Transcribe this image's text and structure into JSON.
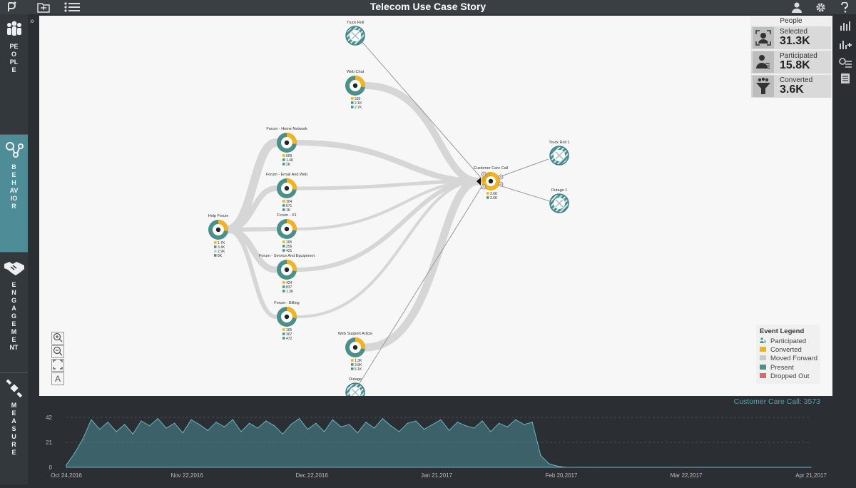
{
  "app": {
    "title": "Telecom Use Case Story",
    "toolbar": {
      "logo_icon": "p-logo-icon",
      "open_icon": "folder-open-icon",
      "list_icon": "list-icon",
      "user_icon": "user-icon",
      "settings_icon": "gear-icon",
      "help_icon": "help-icon"
    }
  },
  "leftnav": {
    "collapse_label": "»",
    "sections": [
      {
        "label": "PEOPLE",
        "icon": "people-icon",
        "active": false
      },
      {
        "label": "BEHAVIOR",
        "icon": "behavior-icon",
        "active": true
      },
      {
        "label": "ENGAGEMENT",
        "icon": "handshake-icon",
        "active": false
      },
      {
        "label": "MEASURE",
        "icon": "satellite-icon",
        "active": false
      }
    ]
  },
  "rightnav": {
    "icons": [
      "bar-chart-icon",
      "add-chart-icon",
      "filter-list-icon",
      "document-icon"
    ]
  },
  "people": {
    "header": "People",
    "cards": [
      {
        "label": "Selected",
        "value": "31.3K",
        "icon": "selected-person-icon"
      },
      {
        "label": "Participated",
        "value": "15.8K",
        "icon": "participated-icon"
      },
      {
        "label": "Converted",
        "value": "3.6K",
        "icon": "funnel-icon"
      }
    ]
  },
  "legend": {
    "title": "Event Legend",
    "items": [
      {
        "label": "Participated",
        "color": "#4a8f8a"
      },
      {
        "label": "Converted",
        "color": "#f0b323"
      },
      {
        "label": "Moved Forward",
        "color": "#c9c9c9"
      },
      {
        "label": "Present",
        "color": "#4a8f8a"
      },
      {
        "label": "Dropped Out",
        "color": "#e06666"
      }
    ]
  },
  "graph": {
    "nodes": [
      {
        "id": "truckroll",
        "label": "Truck Roll",
        "type": "hatched",
        "stats": []
      },
      {
        "id": "webchat",
        "label": "Web Chat",
        "type": "donut",
        "stats": [
          "530",
          "2.1K",
          "2.7K"
        ]
      },
      {
        "id": "home",
        "label": "Forum - Home Network",
        "type": "donut",
        "stats": [
          "669",
          "1.4K",
          "2K"
        ]
      },
      {
        "id": "email",
        "label": "Forum - Email And Web",
        "type": "donut",
        "stats": [
          "304",
          "671",
          "1K"
        ]
      },
      {
        "id": "x1",
        "label": "Forum - X1",
        "type": "donut",
        "stats": [
          "165",
          "256",
          "421"
        ]
      },
      {
        "id": "service",
        "label": "Forum - Service And Equipment",
        "type": "donut",
        "stats": [
          "424",
          "837",
          "1.3K"
        ]
      },
      {
        "id": "billing",
        "label": "Forum - Billing",
        "type": "donut",
        "stats": [
          "165",
          "307",
          "472"
        ]
      },
      {
        "id": "help",
        "label": "Help Forum",
        "type": "donut",
        "stats": [
          "1.7K",
          "3.4K",
          "2.9K",
          "8K"
        ]
      },
      {
        "id": "websupport",
        "label": "Web Support Article",
        "type": "donut",
        "stats": [
          "1.3K",
          "3.8K",
          "5.1K"
        ]
      },
      {
        "id": "outage",
        "label": "Outage",
        "type": "hatched",
        "stats": []
      },
      {
        "id": "ccc",
        "label": "Customer Care Call",
        "type": "donut-main",
        "stats": [
          "3.6K",
          "3.6K"
        ]
      },
      {
        "id": "truckroll1",
        "label": "Truck Roll 1",
        "type": "hatched",
        "stats": []
      },
      {
        "id": "outage1",
        "label": "Outage 1",
        "type": "hatched",
        "stats": []
      }
    ]
  },
  "zoom": {
    "icons": [
      "zoom-in-icon",
      "zoom-out-icon",
      "fit-screen-icon",
      "text-icon"
    ],
    "text_label": "A"
  },
  "status": {
    "text": "Customer Care Call: 3573"
  },
  "chart_data": {
    "type": "area",
    "title": "",
    "xlabel": "",
    "ylabel": "",
    "ylim": [
      0,
      42
    ],
    "yticks": [
      "0",
      "21",
      "42"
    ],
    "xticks": [
      "Oct 24,2016",
      "Nov 22,2016",
      "Dec 22,2016",
      "Jan 21,2017",
      "Feb 20,2017",
      "Mar 22,2017",
      "Apr 21,2017"
    ],
    "x_start": "2016-10-24",
    "x_end": "2017-04-21",
    "grid": true,
    "color": "#4a8a94",
    "series": [
      {
        "x": [
          "2016-10-24",
          "2016-10-26",
          "2016-10-28",
          "2016-10-30",
          "2016-11-01",
          "2016-11-03",
          "2016-11-05",
          "2016-11-07",
          "2016-11-09",
          "2016-11-11",
          "2016-11-13",
          "2016-11-15",
          "2016-11-17",
          "2016-11-19",
          "2016-11-21",
          "2016-11-23",
          "2016-11-25",
          "2016-11-27",
          "2016-11-29",
          "2016-12-01",
          "2016-12-03",
          "2016-12-05",
          "2016-12-07",
          "2016-12-09",
          "2016-12-11",
          "2016-12-13",
          "2016-12-15",
          "2016-12-17",
          "2016-12-19",
          "2016-12-21",
          "2016-12-23",
          "2016-12-25",
          "2016-12-27",
          "2016-12-29",
          "2016-12-31",
          "2017-01-02",
          "2017-01-04",
          "2017-01-06",
          "2017-01-08",
          "2017-01-10",
          "2017-01-12",
          "2017-01-14",
          "2017-01-16",
          "2017-01-18",
          "2017-01-20",
          "2017-01-22",
          "2017-01-24",
          "2017-01-26",
          "2017-01-28",
          "2017-01-30",
          "2017-02-01",
          "2017-02-03",
          "2017-02-05",
          "2017-02-07",
          "2017-02-09",
          "2017-02-11",
          "2017-02-13",
          "2017-02-15",
          "2017-02-17",
          "2017-02-19",
          "2017-02-21",
          "2017-03-01",
          "2017-04-21"
        ],
        "values": [
          2,
          12,
          24,
          40,
          32,
          38,
          30,
          36,
          28,
          39,
          35,
          41,
          33,
          37,
          29,
          40,
          36,
          31,
          38,
          34,
          40,
          30,
          37,
          33,
          39,
          35,
          28,
          36,
          41,
          32,
          37,
          30,
          40,
          34,
          36,
          29,
          38,
          33,
          41,
          35,
          30,
          37,
          39,
          32,
          36,
          40,
          31,
          38,
          35,
          33,
          39,
          30,
          37,
          34,
          40,
          36,
          38,
          10,
          3,
          1,
          0,
          0,
          0
        ]
      }
    ]
  }
}
